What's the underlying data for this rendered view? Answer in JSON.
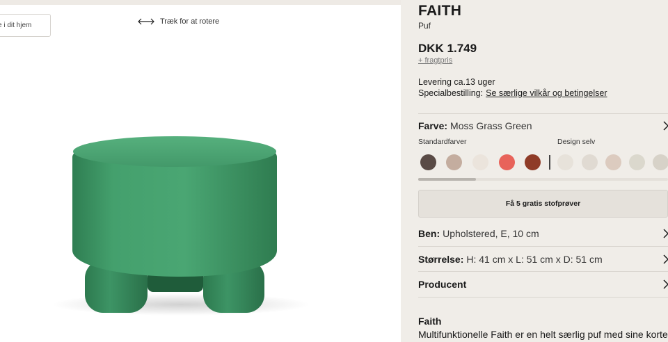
{
  "viewer": {
    "ar_button_label": "e i dit hjem",
    "rotate_hint": "Træk for at rotere"
  },
  "product": {
    "title": "FAITH",
    "subtitle": "Puf",
    "price": "DKK 1.749",
    "shipping_link": "+ fragtpris",
    "delivery": "Levering ca.13 uger",
    "special_order_label": "Specialbestilling:",
    "special_order_link": "Se særlige vilkår og betingelser"
  },
  "color_option": {
    "label": "Farve:",
    "value": "Moss Grass Green",
    "standard_heading": "Standardfarver",
    "custom_heading": "Design selv",
    "swatches": [
      {
        "name": "dark-brown",
        "color": "#5a4b46"
      },
      {
        "name": "taupe",
        "color": "#c4ad9f"
      },
      {
        "name": "cream",
        "color": "#ebe4dc"
      },
      {
        "name": "coral",
        "color": "#e8635a"
      },
      {
        "name": "rust",
        "color": "#8f3b27"
      },
      {
        "name": "ivory",
        "color": "#e7e2da"
      },
      {
        "name": "light-beige",
        "color": "#e0dad2"
      },
      {
        "name": "blush-beige",
        "color": "#dccbbf"
      },
      {
        "name": "stone",
        "color": "#dbd8cd"
      },
      {
        "name": "sand",
        "color": "#d7d2c8"
      }
    ]
  },
  "samples_button": "Få 5 gratis stofprøver",
  "legs_option": {
    "label": "Ben:",
    "value": "Upholstered, E, 10 cm"
  },
  "size_option": {
    "label": "Størrelse:",
    "value": "H: 41 cm x L: 51 cm x D: 51 cm"
  },
  "producer_option": {
    "label": "Producent"
  },
  "description": {
    "title": "Faith",
    "text": "Multifunktionelle Faith er en helt særlig puf med sine korte,"
  },
  "colors": {
    "fabric_green": "#3f9466",
    "panel_bg": "#f0ede8"
  }
}
